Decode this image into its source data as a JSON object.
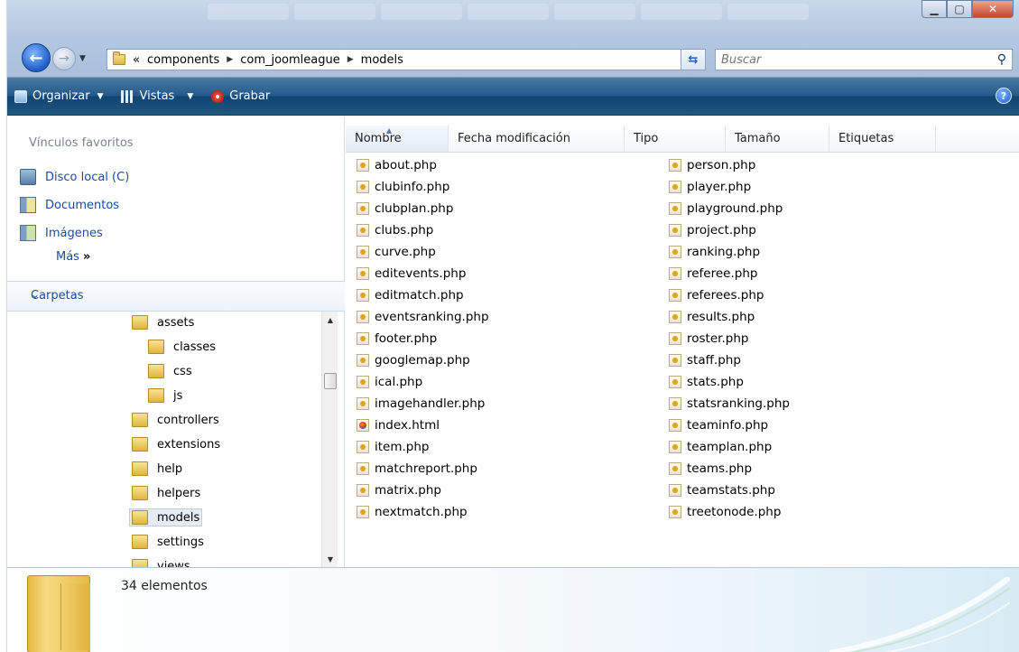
{
  "address": {
    "overflow": "«",
    "crumbs": [
      "components",
      "com_joomleague",
      "models"
    ]
  },
  "search": {
    "placeholder": "Buscar"
  },
  "toolbar": {
    "organize": "Organizar",
    "views": "Vistas",
    "burn": "Grabar"
  },
  "favorites": {
    "header": "Vínculos favoritos",
    "items": [
      "Disco local (C)",
      "Documentos",
      "Imágenes"
    ],
    "more": "Más",
    "more_glyph": "»"
  },
  "folders": {
    "header": "Carpetas",
    "items": [
      "assets",
      "classes",
      "css",
      "js",
      "controllers",
      "extensions",
      "help",
      "helpers",
      "models",
      "settings",
      "views"
    ],
    "selected": "models"
  },
  "columns": [
    "Nombre",
    "Fecha modificación",
    "Tipo",
    "Tamaño",
    "Etiquetas"
  ],
  "files_col1": [
    "about.php",
    "clubinfo.php",
    "clubplan.php",
    "clubs.php",
    "curve.php",
    "editevents.php",
    "editmatch.php",
    "eventsranking.php",
    "footer.php",
    "googlemap.php",
    "ical.php",
    "imagehandler.php",
    "index.html",
    "item.php",
    "matchreport.php",
    "matrix.php",
    "nextmatch.php"
  ],
  "files_col2": [
    "person.php",
    "player.php",
    "playground.php",
    "project.php",
    "ranking.php",
    "referee.php",
    "referees.php",
    "results.php",
    "roster.php",
    "staff.php",
    "stats.php",
    "statsranking.php",
    "teaminfo.php",
    "teamplan.php",
    "teams.php",
    "teamstats.php",
    "treetonode.php"
  ],
  "status": {
    "count": "34 elementos"
  },
  "colors": {
    "toolbar": "#1f5880",
    "link": "#1c4ba0",
    "titlebar": "#b4c8e0"
  }
}
